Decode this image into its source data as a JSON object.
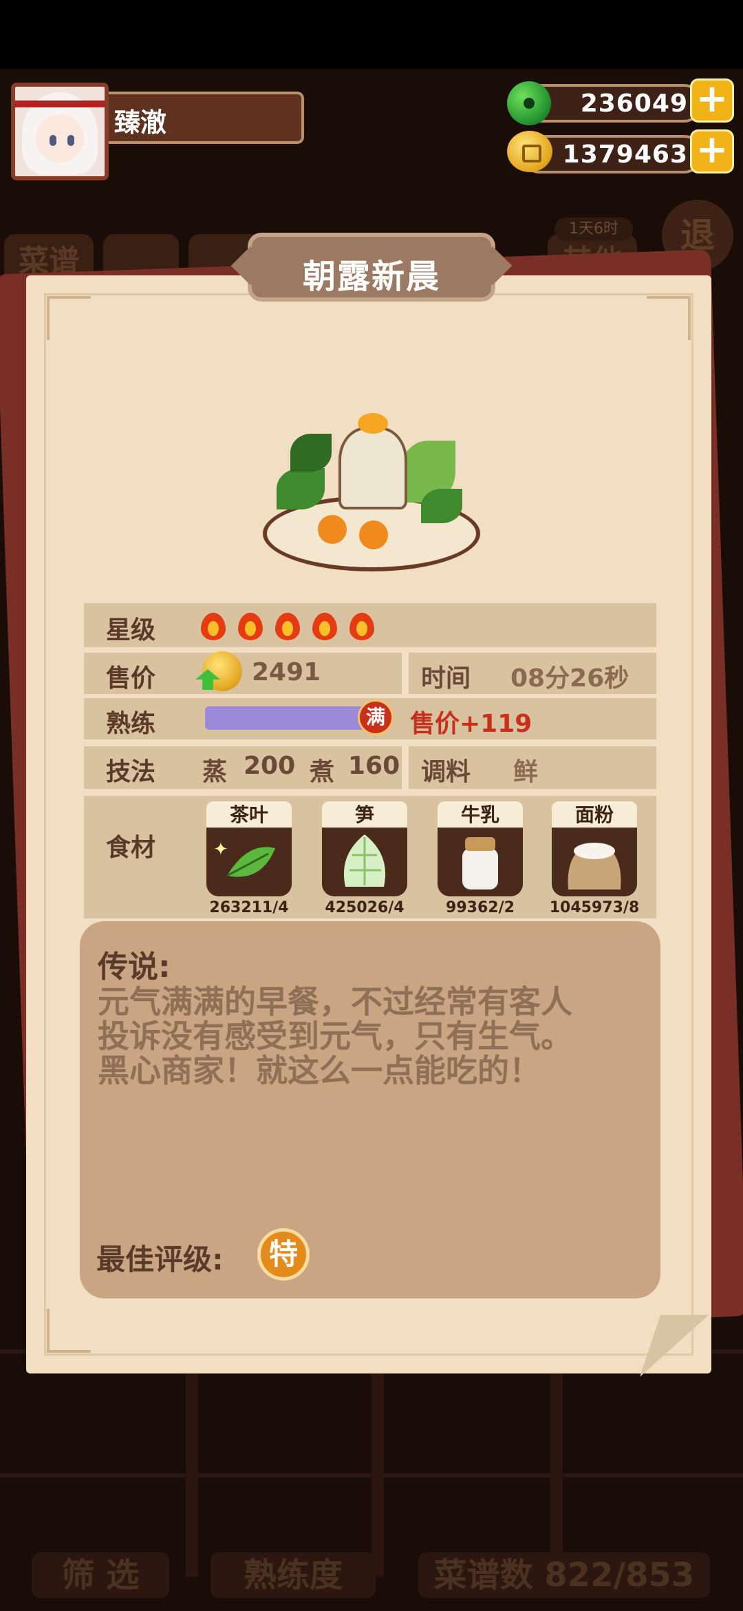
{
  "player": {
    "name": "臻澈"
  },
  "currency": {
    "jade": {
      "value": "236049",
      "icon": "jade-coin-icon"
    },
    "gold": {
      "value": "1379463",
      "icon": "gold-coin-icon"
    }
  },
  "background": {
    "tabs": [
      "菜谱",
      "其他"
    ],
    "timer_badge": "1天6时",
    "exit_label": "退",
    "bottom": {
      "filter": "筛 选",
      "mastery": "熟练度",
      "recipe_count": "菜谱数 822/853"
    }
  },
  "recipe": {
    "title": "朝露新晨",
    "star_label": "星级",
    "stars": 5,
    "price_label": "售价",
    "price": "2491",
    "time_label": "时间",
    "time": "08分26秒",
    "mastery_label": "熟练",
    "mastery_progress": 1.0,
    "mastery_badge": "满",
    "mastery_bonus": "售价+119",
    "technique_label": "技法",
    "technique_steam_name": "蒸",
    "technique_steam_value": "200",
    "technique_boil_name": "煮",
    "technique_boil_value": "160",
    "seasoning_label": "调料",
    "seasoning": "鲜",
    "ingredients_label": "食材",
    "ingredients": [
      {
        "name": "茶叶",
        "count": "263211/4",
        "icon": "tea-leaf-icon"
      },
      {
        "name": "笋",
        "count": "425026/4",
        "icon": "bamboo-shoot-icon"
      },
      {
        "name": "牛乳",
        "count": "99362/2",
        "icon": "milk-jar-icon"
      },
      {
        "name": "面粉",
        "count": "1045973/8",
        "icon": "flour-sack-icon"
      }
    ],
    "legend_title": "传说:",
    "legend_text": "元气满满的早餐，不过经常有客人投诉没有感受到元气，只有生气。黑心商家！就这么一点能吃的！",
    "best_grade_label": "最佳评级:",
    "best_grade": "特"
  },
  "colors": {
    "accent_red": "#c9301c",
    "card_bg": "#f2dfc3",
    "row_bg": "#d9c2a0"
  }
}
